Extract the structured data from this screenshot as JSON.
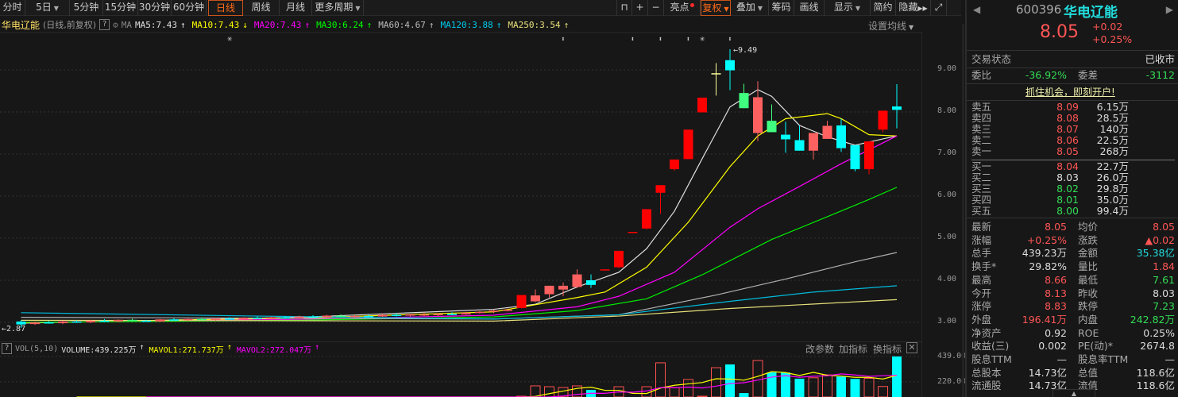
{
  "toolbar": {
    "periods": [
      "分时",
      "5日",
      "5分钟",
      "15分钟",
      "30分钟",
      "60分钟",
      "日线",
      "周线",
      "月线",
      "更多周期"
    ],
    "tools": [
      "亮点",
      "复权",
      "叠加",
      "筹码",
      "画线",
      "显示",
      "简约",
      "隐藏"
    ]
  },
  "legend": {
    "name": "华电辽能",
    "mode": "(日线,前复权)",
    "help": "?",
    "ma_label": "MA",
    "items": [
      {
        "text": "MA5:7.43",
        "arrow": "↑",
        "color": "#e0e0e0"
      },
      {
        "text": "MA10:7.43",
        "arrow": "↓",
        "color": "#ffff00"
      },
      {
        "text": "MA20:7.43",
        "arrow": "↑",
        "color": "#ff00ff"
      },
      {
        "text": "MA30:6.24",
        "arrow": "↑",
        "color": "#00ff00"
      },
      {
        "text": "MA60:4.67",
        "arrow": "↑",
        "color": "#bbbbbb"
      },
      {
        "text": "MA120:3.88",
        "arrow": "↑",
        "color": "#00ccee"
      },
      {
        "text": "MA250:3.54",
        "arrow": "↑",
        "color": "#e8e07a"
      }
    ],
    "set_ma": "设置均线"
  },
  "chart_data": {
    "type": "candlestick",
    "y_ticks": [
      "9.00",
      "8.00",
      "7.00",
      "6.00",
      "5.00",
      "4.00",
      "3.00"
    ],
    "ylim": [
      2.8,
      9.6
    ],
    "high_label": "9.49",
    "low_label": "2.87",
    "colors": {
      "R": "#ff0000",
      "r": "#ff6060",
      "c": "#00ffff",
      "g": "#40ff80",
      "y": "#ffff99"
    },
    "candles": [
      [
        3.02,
        3.05,
        2.87,
        2.95,
        "c"
      ],
      [
        2.96,
        3.02,
        2.94,
        3.0,
        "r"
      ],
      [
        3.0,
        3.03,
        2.97,
        2.98,
        "c"
      ],
      [
        2.98,
        3.04,
        2.96,
        3.02,
        "r"
      ],
      [
        3.02,
        3.05,
        2.99,
        3.0,
        "c"
      ],
      [
        3.0,
        3.06,
        2.98,
        3.04,
        "r"
      ],
      [
        3.04,
        3.08,
        3.01,
        3.02,
        "c"
      ],
      [
        3.02,
        3.07,
        3.0,
        3.06,
        "r"
      ],
      [
        3.06,
        3.09,
        3.02,
        3.04,
        "g"
      ],
      [
        3.04,
        3.06,
        3.01,
        3.02,
        "c"
      ],
      [
        3.02,
        3.08,
        3.01,
        3.07,
        "r"
      ],
      [
        3.07,
        3.1,
        3.04,
        3.05,
        "c"
      ],
      [
        3.05,
        3.09,
        3.03,
        3.08,
        "r"
      ],
      [
        3.08,
        3.11,
        3.05,
        3.06,
        "g"
      ],
      [
        3.06,
        3.1,
        3.04,
        3.09,
        "r"
      ],
      [
        3.09,
        3.12,
        3.06,
        3.07,
        "c"
      ],
      [
        3.07,
        3.12,
        3.06,
        3.11,
        "r"
      ],
      [
        3.11,
        3.14,
        3.08,
        3.09,
        "c"
      ],
      [
        3.09,
        3.13,
        3.07,
        3.12,
        "r"
      ],
      [
        3.12,
        3.15,
        3.09,
        3.1,
        "c"
      ],
      [
        3.1,
        3.16,
        3.09,
        3.14,
        "r"
      ],
      [
        3.14,
        3.17,
        3.11,
        3.12,
        "c"
      ],
      [
        3.12,
        3.18,
        3.11,
        3.16,
        "r"
      ],
      [
        3.16,
        3.19,
        3.12,
        3.13,
        "g"
      ],
      [
        3.13,
        3.17,
        3.11,
        3.15,
        "r"
      ],
      [
        3.15,
        3.18,
        3.12,
        3.14,
        "c"
      ],
      [
        3.14,
        3.2,
        3.13,
        3.18,
        "r"
      ],
      [
        3.18,
        3.22,
        3.14,
        3.16,
        "c"
      ],
      [
        3.16,
        3.2,
        3.14,
        3.19,
        "r"
      ],
      [
        3.19,
        3.24,
        3.15,
        3.17,
        "r"
      ],
      [
        3.17,
        3.22,
        3.15,
        3.2,
        "r"
      ],
      [
        3.2,
        3.24,
        3.17,
        3.19,
        "c"
      ],
      [
        3.19,
        3.25,
        3.18,
        3.23,
        "r"
      ],
      [
        3.23,
        3.27,
        3.21,
        3.25,
        "r"
      ],
      [
        3.25,
        3.3,
        3.22,
        3.28,
        "r"
      ],
      [
        3.28,
        3.33,
        3.26,
        3.3,
        "r"
      ],
      [
        3.34,
        3.65,
        3.33,
        3.65,
        "R"
      ],
      [
        3.5,
        3.78,
        3.48,
        3.64,
        "r"
      ],
      [
        3.67,
        3.87,
        3.59,
        3.87,
        "r"
      ],
      [
        3.78,
        3.95,
        3.62,
        3.87,
        "r"
      ],
      [
        3.84,
        4.26,
        3.82,
        4.14,
        "r"
      ],
      [
        4.0,
        4.14,
        3.82,
        3.89,
        "c"
      ],
      [
        4.26,
        4.26,
        4.26,
        4.26,
        "R"
      ],
      [
        4.31,
        4.7,
        4.29,
        4.7,
        "R"
      ],
      [
        5.15,
        5.15,
        5.15,
        5.15,
        "R"
      ],
      [
        5.23,
        5.69,
        5.21,
        5.69,
        "R"
      ],
      [
        6.08,
        6.26,
        5.58,
        6.26,
        "R"
      ],
      [
        6.64,
        6.87,
        6.6,
        6.87,
        "R"
      ],
      [
        6.88,
        7.58,
        6.88,
        7.58,
        "R"
      ],
      [
        7.99,
        8.34,
        7.99,
        8.34,
        "R"
      ],
      [
        8.92,
        9.16,
        8.39,
        8.92,
        "y"
      ],
      [
        9.23,
        9.49,
        8.52,
        8.99,
        "c"
      ],
      [
        8.45,
        8.67,
        8.09,
        8.09,
        "g"
      ],
      [
        8.35,
        8.73,
        7.31,
        7.5,
        "r"
      ],
      [
        7.79,
        8.18,
        7.52,
        7.52,
        "g"
      ],
      [
        7.46,
        7.77,
        7.03,
        7.35,
        "c"
      ],
      [
        7.33,
        7.68,
        7.08,
        7.08,
        "c"
      ],
      [
        7.08,
        7.5,
        6.87,
        7.5,
        "r"
      ],
      [
        7.36,
        7.79,
        7.36,
        7.67,
        "r"
      ],
      [
        7.68,
        7.84,
        7.05,
        7.14,
        "c"
      ],
      [
        7.21,
        7.21,
        6.59,
        6.64,
        "c"
      ],
      [
        6.64,
        7.31,
        6.52,
        7.3,
        "R"
      ],
      [
        7.58,
        8.03,
        7.52,
        8.03,
        "R"
      ],
      [
        8.13,
        8.66,
        7.61,
        8.05,
        "c"
      ]
    ],
    "markers": [
      [
        15,
        "star"
      ],
      [
        39,
        "arrow"
      ],
      [
        44,
        "arrow"
      ],
      [
        46,
        "arrow"
      ],
      [
        48,
        "arrow"
      ],
      [
        49,
        "star"
      ],
      [
        51,
        "arrow"
      ]
    ],
    "ma_series": [
      {
        "name": "MA5",
        "color": "#e0e0e0",
        "points": [
          [
            0,
            2.98
          ],
          [
            20,
            3.12
          ],
          [
            34,
            3.31
          ],
          [
            37,
            3.43
          ],
          [
            40,
            3.84
          ],
          [
            43,
            4.19
          ],
          [
            45,
            4.75
          ],
          [
            47,
            5.64
          ],
          [
            49,
            6.89
          ],
          [
            51,
            8.12
          ],
          [
            53,
            8.53
          ],
          [
            54,
            8.37
          ],
          [
            56,
            7.68
          ],
          [
            58,
            7.41
          ],
          [
            60,
            7.21
          ],
          [
            62,
            7.36
          ],
          [
            63,
            7.43
          ]
        ]
      },
      {
        "name": "MA10",
        "color": "#ffff00",
        "points": [
          [
            0,
            2.99
          ],
          [
            20,
            3.1
          ],
          [
            34,
            3.25
          ],
          [
            40,
            3.59
          ],
          [
            42,
            3.72
          ],
          [
            45,
            4.31
          ],
          [
            48,
            5.38
          ],
          [
            51,
            6.7
          ],
          [
            53,
            7.43
          ],
          [
            55,
            7.84
          ],
          [
            58,
            7.96
          ],
          [
            59,
            7.84
          ],
          [
            61,
            7.46
          ],
          [
            63,
            7.43
          ]
        ]
      },
      {
        "name": "MA20",
        "color": "#ff00ff",
        "points": [
          [
            0,
            3.0
          ],
          [
            20,
            3.07
          ],
          [
            34,
            3.17
          ],
          [
            40,
            3.37
          ],
          [
            43,
            3.62
          ],
          [
            47,
            4.19
          ],
          [
            51,
            5.26
          ],
          [
            53,
            5.7
          ],
          [
            56,
            6.23
          ],
          [
            59,
            6.77
          ],
          [
            63,
            7.43
          ]
        ]
      },
      {
        "name": "MA30",
        "color": "#00ee00",
        "points": [
          [
            0,
            3.0
          ],
          [
            20,
            3.05
          ],
          [
            34,
            3.13
          ],
          [
            40,
            3.28
          ],
          [
            45,
            3.56
          ],
          [
            49,
            4.13
          ],
          [
            54,
            4.97
          ],
          [
            58,
            5.51
          ],
          [
            61,
            5.92
          ],
          [
            63,
            6.21
          ]
        ]
      },
      {
        "name": "MA60",
        "color": "#b0b0b0",
        "points": [
          [
            0,
            3.12
          ],
          [
            34,
            3.08
          ],
          [
            43,
            3.18
          ],
          [
            50,
            3.65
          ],
          [
            55,
            4.03
          ],
          [
            60,
            4.44
          ],
          [
            63,
            4.66
          ]
        ]
      },
      {
        "name": "MA120",
        "color": "#00bbdd",
        "points": [
          [
            0,
            3.23
          ],
          [
            17,
            3.15
          ],
          [
            34,
            3.08
          ],
          [
            43,
            3.18
          ],
          [
            51,
            3.5
          ],
          [
            57,
            3.72
          ],
          [
            63,
            3.87
          ]
        ]
      },
      {
        "name": "MA250",
        "color": "#e8e07a",
        "points": [
          [
            0,
            3.05
          ],
          [
            34,
            3.03
          ],
          [
            43,
            3.15
          ],
          [
            51,
            3.33
          ],
          [
            63,
            3.54
          ]
        ]
      }
    ],
    "volume": {
      "y_ticks": [
        "439.00",
        "220.00"
      ],
      "values": [
        40,
        35,
        30,
        42,
        38,
        45,
        33,
        40,
        36,
        30,
        44,
        38,
        41,
        35,
        47,
        39,
        43,
        37,
        45,
        40,
        48,
        42,
        50,
        44,
        46,
        41,
        52,
        45,
        49,
        55,
        51,
        47,
        58,
        60,
        62,
        70,
        96,
        185,
        178,
        171,
        185,
        150,
        50,
        178,
        40,
        178,
        384,
        171,
        240,
        96,
        342,
        370,
        123,
        404,
        301,
        300,
        247,
        255,
        280,
        265,
        245,
        250,
        180,
        439
      ]
    }
  },
  "volume_header": {
    "help": "?",
    "name": "VOL(5,10)",
    "items": [
      {
        "text": "VOLUME:439.225万",
        "arrow": "↑",
        "color": "#e0e0e0"
      },
      {
        "text": "MAVOL1:271.737万",
        "arrow": "↑",
        "color": "#ffff00"
      },
      {
        "text": "MAVOL2:272.047万",
        "arrow": "↑",
        "color": "#ff00ff"
      }
    ],
    "tools": [
      "改参数",
      "加指标",
      "换指标"
    ]
  },
  "quote": {
    "code": "600396",
    "name": "华电辽能",
    "price": "8.05",
    "change": "+0.02",
    "change_pct": "+0.25%",
    "status_label": "交易状态",
    "status": "已收市",
    "weibi_label": "委比",
    "weibi": "-36.92%",
    "weicha_label": "委差",
    "weicha": "-3112",
    "banner": "抓住机会，即刻开户!",
    "asks": [
      {
        "label": "卖五",
        "price": "8.09",
        "vol": "6.15万",
        "c": "red"
      },
      {
        "label": "卖四",
        "price": "8.08",
        "vol": "28.5万",
        "c": "red"
      },
      {
        "label": "卖三",
        "price": "8.07",
        "vol": "140万",
        "c": "red"
      },
      {
        "label": "卖二",
        "price": "8.06",
        "vol": "22.5万",
        "c": "red"
      },
      {
        "label": "卖一",
        "price": "8.05",
        "vol": "268万",
        "c": "red"
      }
    ],
    "bids": [
      {
        "label": "买一",
        "price": "8.04",
        "vol": "22.7万",
        "c": "red"
      },
      {
        "label": "买二",
        "price": "8.03",
        "vol": "26.0万",
        "c": "white"
      },
      {
        "label": "买三",
        "price": "8.02",
        "vol": "29.8万",
        "c": "green"
      },
      {
        "label": "买四",
        "price": "8.01",
        "vol": "35.0万",
        "c": "green"
      },
      {
        "label": "买五",
        "price": "8.00",
        "vol": "99.4万",
        "c": "green"
      }
    ],
    "stats": [
      {
        "l1": "最新",
        "v1": "8.05",
        "c1": "red",
        "l2": "均价",
        "v2": "8.05",
        "c2": "red"
      },
      {
        "l1": "涨幅",
        "v1": "+0.25%",
        "c1": "red",
        "l2": "涨跌",
        "v2": "▲0.02",
        "c2": "red"
      },
      {
        "l1": "总手",
        "v1": "439.23万",
        "c1": "white",
        "l2": "金额",
        "v2": "35.38亿",
        "c2": "cyan"
      },
      {
        "l1": "换手*",
        "v1": "29.82%",
        "c1": "white",
        "l2": "量比",
        "v2": "1.84",
        "c2": "red"
      },
      {
        "l1": "最高",
        "v1": "8.66",
        "c1": "red",
        "l2": "最低",
        "v2": "7.61",
        "c2": "green"
      },
      {
        "l1": "今开",
        "v1": "8.13",
        "c1": "red",
        "l2": "昨收",
        "v2": "8.03",
        "c2": "white"
      },
      {
        "l1": "涨停",
        "v1": "8.83",
        "c1": "red",
        "l2": "跌停",
        "v2": "7.23",
        "c2": "green"
      },
      {
        "l1": "外盘",
        "v1": "196.41万",
        "c1": "red",
        "l2": "内盘",
        "v2": "242.82万",
        "c2": "green"
      },
      {
        "l1": "净资产",
        "v1": "0.92",
        "c1": "white",
        "l2": "ROE",
        "v2": "0.25%",
        "c2": "white"
      },
      {
        "l1": "收益(三)",
        "v1": "0.002",
        "c1": "white",
        "l2": "PE(动)*",
        "v2": "2674.8",
        "c2": "white"
      },
      {
        "l1": "股息TTM",
        "v1": "—",
        "c1": "white",
        "l2": "股息率TTM",
        "v2": "—",
        "c2": "white"
      },
      {
        "l1": "总股本",
        "v1": "14.73亿",
        "c1": "white",
        "l2": "总值",
        "v2": "118.6亿",
        "c2": "white"
      },
      {
        "l1": "流通股",
        "v1": "14.73亿",
        "c1": "white",
        "l2": "流值",
        "v2": "118.6亿",
        "c2": "white"
      }
    ]
  }
}
